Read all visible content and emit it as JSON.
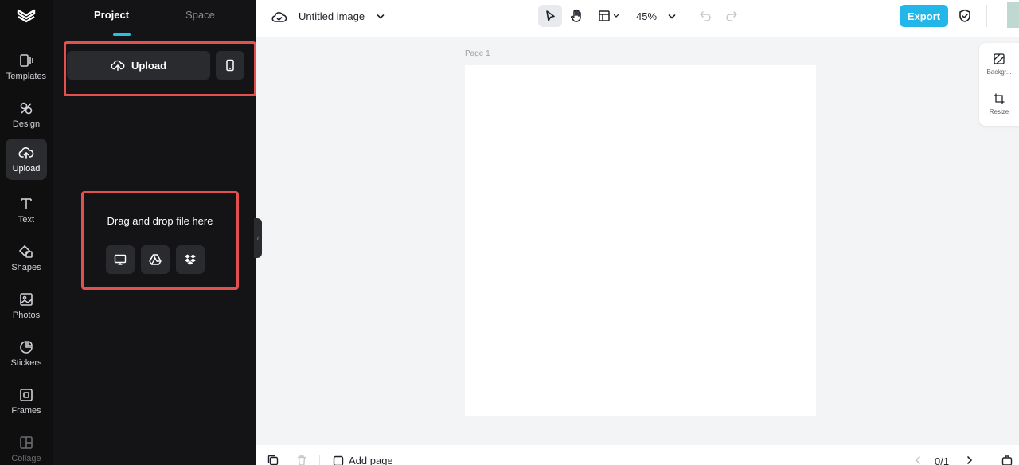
{
  "rail": {
    "items": [
      {
        "label": "Templates",
        "icon": "templates-icon"
      },
      {
        "label": "Design",
        "icon": "design-icon"
      },
      {
        "label": "Upload",
        "icon": "upload-cloud-icon",
        "active": true
      },
      {
        "label": "Text",
        "icon": "text-icon"
      },
      {
        "label": "Shapes",
        "icon": "shapes-icon"
      },
      {
        "label": "Photos",
        "icon": "photos-icon"
      },
      {
        "label": "Stickers",
        "icon": "stickers-icon"
      },
      {
        "label": "Frames",
        "icon": "frames-icon"
      },
      {
        "label": "Collage",
        "icon": "collage-icon"
      }
    ]
  },
  "panel": {
    "tabs": [
      {
        "label": "Project",
        "active": true
      },
      {
        "label": "Space",
        "active": false
      }
    ],
    "upload_label": "Upload",
    "drop_text": "Drag and drop file here",
    "sources": [
      "computer-icon",
      "google-drive-icon",
      "dropbox-icon"
    ]
  },
  "topbar": {
    "title": "Untitled image",
    "zoom": "45%",
    "export_label": "Export"
  },
  "canvas": {
    "page_label": "Page 1"
  },
  "right_panel": {
    "items": [
      {
        "label": "Backgr...",
        "icon": "background-icon"
      },
      {
        "label": "Resize",
        "icon": "resize-icon"
      }
    ]
  },
  "bottombar": {
    "add_page_label": "Add page",
    "pager": "0/1"
  },
  "colors": {
    "accent": "#22b7e8",
    "highlight": "#e25050",
    "rail_bg": "#0f0f10",
    "panel_bg": "#141416"
  }
}
